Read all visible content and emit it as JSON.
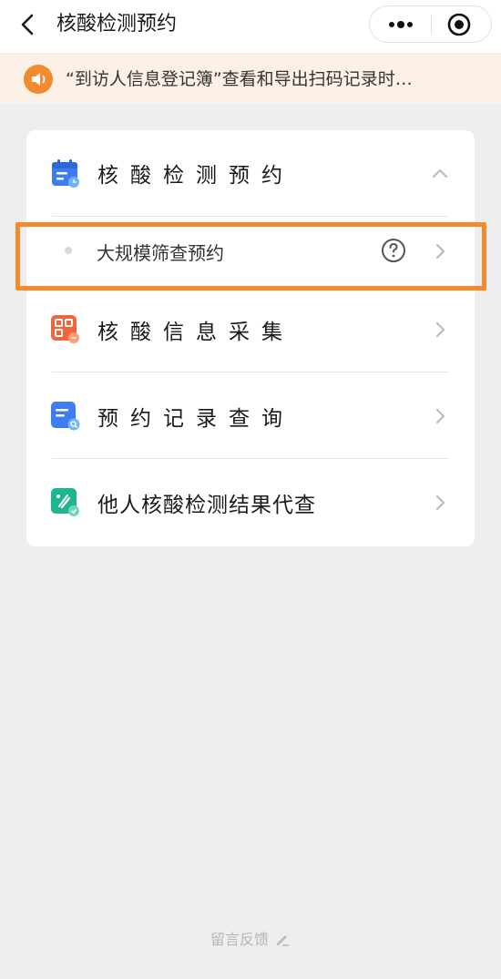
{
  "navbar": {
    "title": "核酸检测预约",
    "back_icon": "back-arrow-icon",
    "more_icon": "more-dots-icon",
    "close_icon": "mini-program-close-icon"
  },
  "notice": {
    "icon": "speaker-icon",
    "text": "“到访人信息登记簿”查看和导出扫码记录时…",
    "color": "#f28a2e"
  },
  "menu": {
    "section": {
      "title": "核酸检测预约",
      "icon": "calendar-icon",
      "expanded": true,
      "subitems": [
        {
          "label": "大规模筛查预约",
          "help_icon": "question-circle-icon"
        }
      ]
    },
    "items": [
      {
        "label": "核酸信息采集",
        "icon": "qr-grid-icon"
      },
      {
        "label": "预约记录查询",
        "icon": "document-search-icon"
      },
      {
        "label": "他人核酸检测结果代查",
        "icon": "test-tube-icon"
      }
    ]
  },
  "highlight_color": "#f28a2e",
  "footer": {
    "label": "留言反馈",
    "icon": "pencil-icon"
  }
}
